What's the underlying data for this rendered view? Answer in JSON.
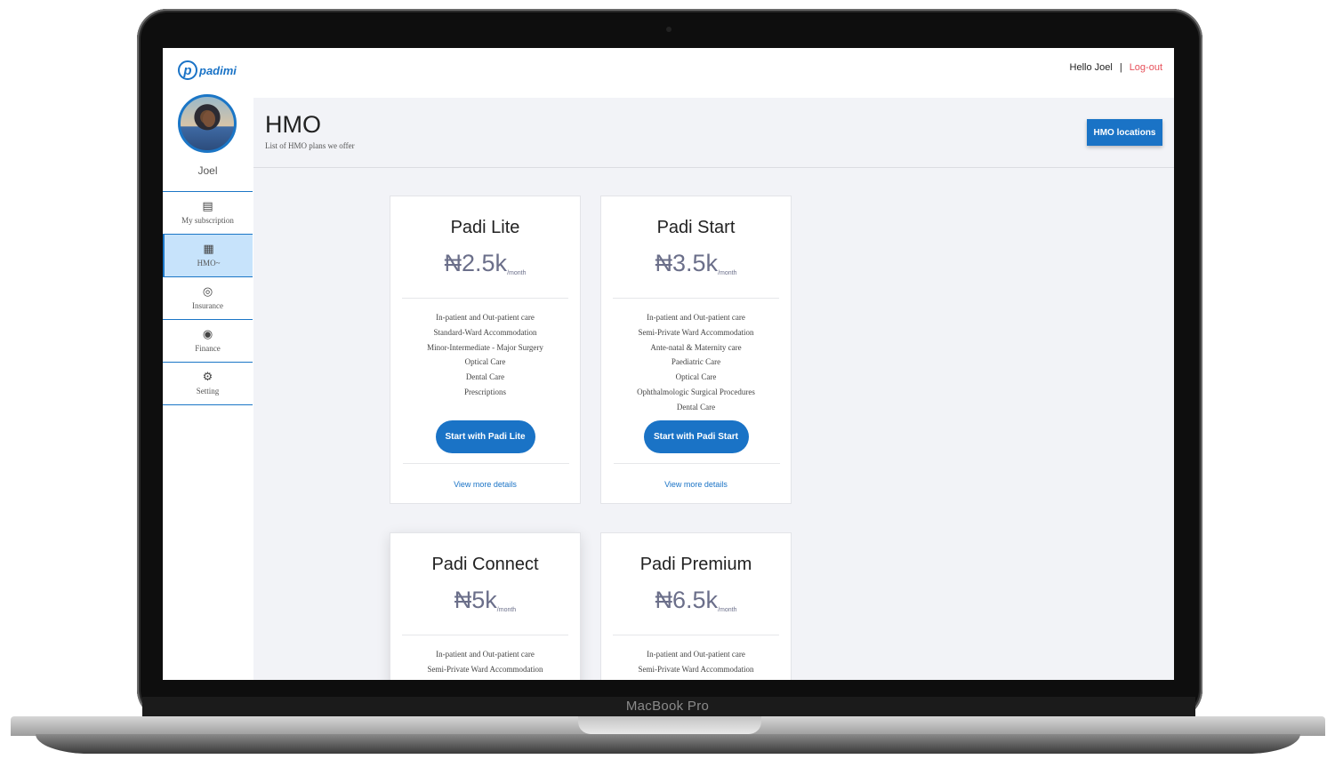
{
  "device": {
    "label": "MacBook Pro"
  },
  "app": {
    "logo_text": "padimi",
    "logo_letter": "p"
  },
  "topbar": {
    "greeting": "Hello Joel",
    "separator": "|",
    "logout": "Log-out"
  },
  "user": {
    "name": "Joel"
  },
  "sidebar": {
    "items": [
      {
        "label": "My subscription",
        "icon": "document-check-icon",
        "glyph": "▤"
      },
      {
        "label": "HMO~",
        "icon": "hmo-icon",
        "glyph": "▦",
        "active": true
      },
      {
        "label": "Insurance",
        "icon": "insurance-icon",
        "glyph": "◎"
      },
      {
        "label": "Finance",
        "icon": "finance-icon",
        "glyph": "◉"
      },
      {
        "label": "Setting",
        "icon": "gear-icon",
        "glyph": "⚙"
      }
    ]
  },
  "page": {
    "title": "HMO",
    "subtitle": "List of HMO plans we offer",
    "locations_button": "HMO locations"
  },
  "plans": [
    {
      "name": "Padi Lite",
      "price": "₦2.5k",
      "period": "/month",
      "features": [
        "In-patient and Out-patient care",
        "Standard-Ward Accommodation",
        "Minor-Intermediate - Major Surgery",
        "Optical Care",
        "Dental Care",
        "Prescriptions"
      ],
      "button": "Start with Padi Lite",
      "more": "View more details"
    },
    {
      "name": "Padi Start",
      "price": "₦3.5k",
      "period": "/month",
      "features": [
        "In-patient and Out-patient care",
        "Semi-Private Ward Accommodation",
        "Ante-natal & Maternity care",
        "Paediatric Care",
        "Optical Care",
        "Ophthalmologic Surgical Procedures",
        "Dental Care"
      ],
      "button": "Start with Padi Start",
      "more": "View more details"
    },
    {
      "name": "Padi Connect",
      "price": "₦5k",
      "period": "/month",
      "features": [
        "In-patient and Out-patient care",
        "Semi-Private Ward Accommodation"
      ]
    },
    {
      "name": "Padi Premium",
      "price": "₦6.5k",
      "period": "/month",
      "features": [
        "In-patient and Out-patient care",
        "Semi-Private Ward Accommodation"
      ]
    }
  ],
  "colors": {
    "accent": "#1a73c6",
    "logout": "#e7505a",
    "active_nav": "#c7e3fb",
    "background": "#f2f3f7",
    "price": "#6b6f8a"
  }
}
